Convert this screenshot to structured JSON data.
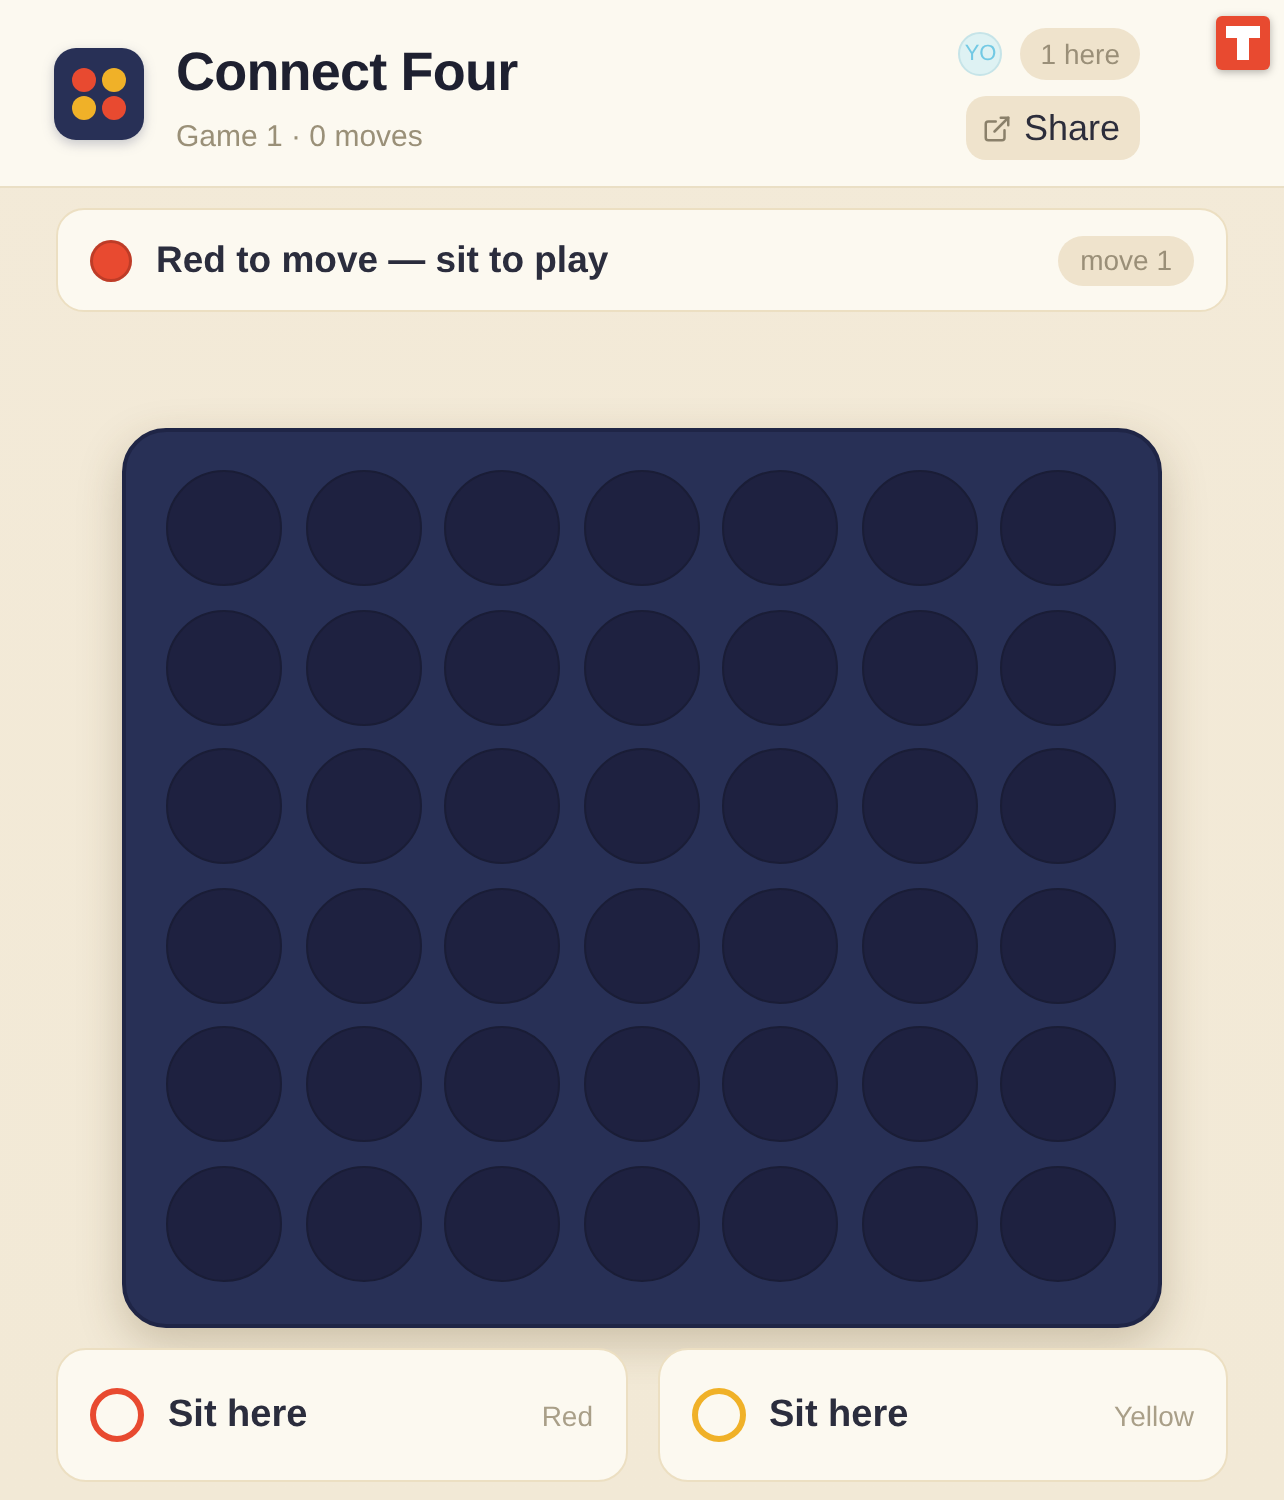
{
  "app": {
    "title": "Connect Four",
    "subtitle": "Game 1 · 0 moves"
  },
  "presence": {
    "avatar": "YO",
    "count": "1 here"
  },
  "share": {
    "label": "Share"
  },
  "status": {
    "text": "Red to move — sit to play",
    "color": "#e84a30",
    "move": "move 1"
  },
  "board": {
    "rows": [
      {
        "cells": [
          {
            "kind": "empty"
          },
          {
            "kind": "empty"
          },
          {
            "kind": "empty"
          },
          {
            "kind": "empty"
          },
          {
            "kind": "empty"
          },
          {
            "kind": "empty"
          },
          {
            "kind": "empty"
          }
        ]
      },
      {
        "cells": [
          {
            "kind": "empty"
          },
          {
            "kind": "empty"
          },
          {
            "kind": "empty"
          },
          {
            "kind": "empty"
          },
          {
            "kind": "empty"
          },
          {
            "kind": "empty"
          },
          {
            "kind": "empty"
          }
        ]
      },
      {
        "cells": [
          {
            "kind": "empty"
          },
          {
            "kind": "empty"
          },
          {
            "kind": "empty"
          },
          {
            "kind": "empty"
          },
          {
            "kind": "empty"
          },
          {
            "kind": "empty"
          },
          {
            "kind": "empty"
          }
        ]
      },
      {
        "cells": [
          {
            "kind": "empty"
          },
          {
            "kind": "empty"
          },
          {
            "kind": "empty"
          },
          {
            "kind": "empty"
          },
          {
            "kind": "empty"
          },
          {
            "kind": "empty"
          },
          {
            "kind": "empty"
          }
        ]
      },
      {
        "cells": [
          {
            "kind": "empty"
          },
          {
            "kind": "empty"
          },
          {
            "kind": "empty"
          },
          {
            "kind": "empty"
          },
          {
            "kind": "empty"
          },
          {
            "kind": "empty"
          },
          {
            "kind": "empty"
          }
        ]
      },
      {
        "cells": [
          {
            "kind": "empty"
          },
          {
            "kind": "empty"
          },
          {
            "kind": "empty"
          },
          {
            "kind": "empty"
          },
          {
            "kind": "empty"
          },
          {
            "kind": "empty"
          },
          {
            "kind": "empty"
          }
        ]
      }
    ]
  },
  "seats": [
    {
      "label": "Sit here",
      "side": "Red",
      "color": "#e84a30"
    },
    {
      "label": "Sit here",
      "side": "Yellow",
      "color": "#f0b128"
    }
  ]
}
